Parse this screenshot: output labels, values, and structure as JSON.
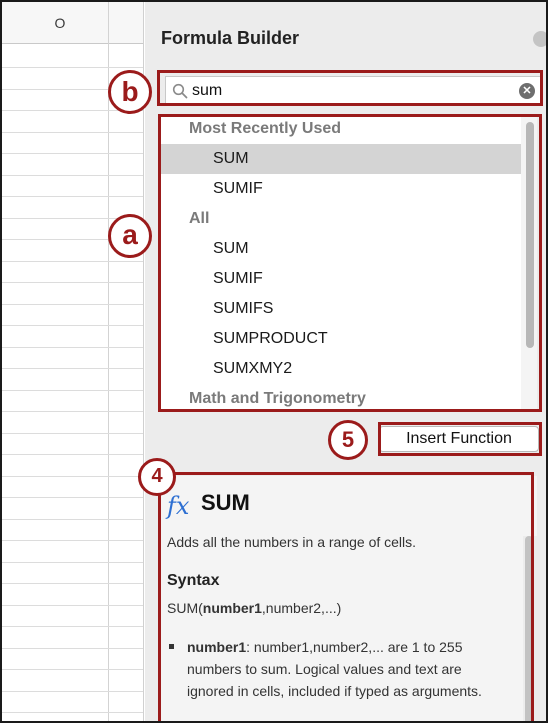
{
  "sheet": {
    "column_label": "O"
  },
  "panel": {
    "title": "Formula Builder",
    "search": {
      "value": "sum",
      "placeholder": ""
    },
    "list": {
      "groups": [
        {
          "header": "Most Recently Used",
          "items": [
            "SUM",
            "SUMIF"
          ]
        },
        {
          "header": "All",
          "items": [
            "SUM",
            "SUMIF",
            "SUMIFS",
            "SUMPRODUCT",
            "SUMXMY2"
          ]
        },
        {
          "header": "Math and Trigonometry",
          "items": []
        }
      ],
      "selected": "SUM"
    },
    "insert_button": "Insert Function",
    "description": {
      "fx": "fx",
      "name": "SUM",
      "text": "Adds all the numbers in a range of cells.",
      "syntax_heading": "Syntax",
      "syntax_func": "SUM(",
      "syntax_bold": "number1",
      "syntax_rest": ",number2,...)",
      "arg_name": "number1",
      "arg_text": ": number1,number2,... are 1 to 255 numbers to sum. Logical values and text are ignored in cells, included if typed as arguments."
    }
  },
  "annotations": {
    "b": "b",
    "a": "a",
    "five": "5",
    "four": "4"
  },
  "colors": {
    "annotation": "#9b1b1b",
    "fx_blue": "#2d6fd2",
    "selected_row": "#d4d4d4"
  },
  "icons": {
    "search": "search-icon",
    "clear": "clear-search-icon",
    "close": "close-icon"
  }
}
